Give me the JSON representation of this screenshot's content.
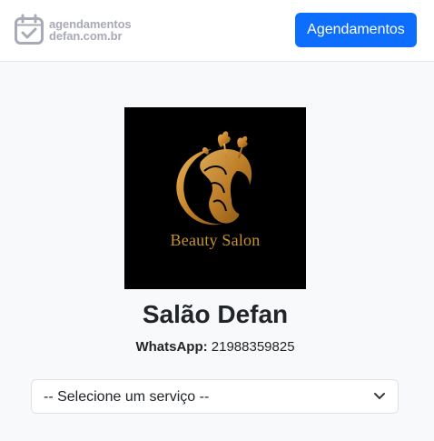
{
  "navbar": {
    "brand_line1": "agendamentos",
    "brand_line2": "defan.com.br",
    "brand_icon": "calendar-check-icon",
    "button_label": "Agendamentos",
    "button_color": "#0d6efd"
  },
  "salon": {
    "logo_text": "Beauty Salon",
    "name": "Salão Defan",
    "whatsapp_label": "WhatsApp:",
    "whatsapp_number": "21988359825"
  },
  "service_select": {
    "selected": "-- Selecione um serviço --",
    "icon": "chevron-down-icon"
  },
  "colors": {
    "page_bg": "#f8f9fa",
    "logo_gold": "#c8932f",
    "brand_grey": "#a8aab7"
  }
}
